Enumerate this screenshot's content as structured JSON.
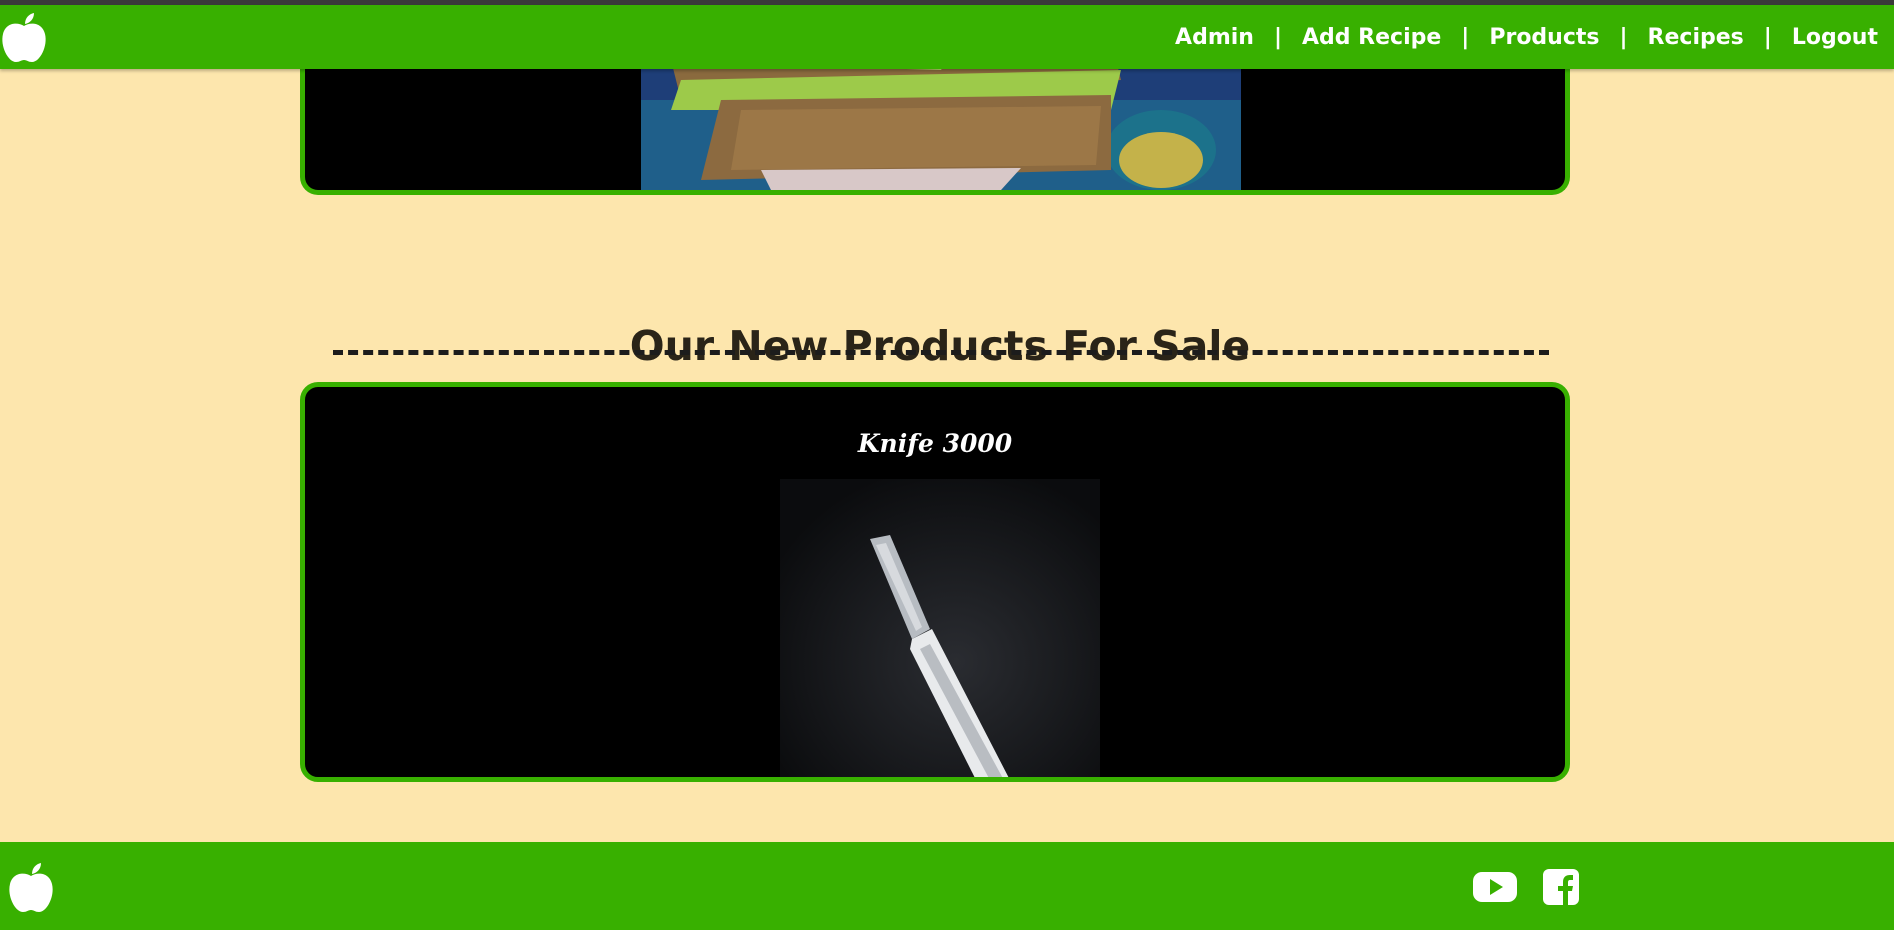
{
  "nav": {
    "items": [
      {
        "label": "Admin"
      },
      {
        "label": "Add Recipe"
      },
      {
        "label": "Products"
      },
      {
        "label": "Recipes"
      },
      {
        "label": "Logout"
      }
    ],
    "separator": "|"
  },
  "products_section": {
    "title": "Our New Products For Sale",
    "items": [
      {
        "name": "Knife 3000"
      }
    ]
  },
  "icons": {
    "logo": "apple-icon",
    "social": [
      "youtube-icon",
      "facebook-icon"
    ]
  },
  "colors": {
    "primary": "#38b000",
    "background": "#fde6ad",
    "card": "#000000",
    "text_dark": "#2a2418"
  }
}
